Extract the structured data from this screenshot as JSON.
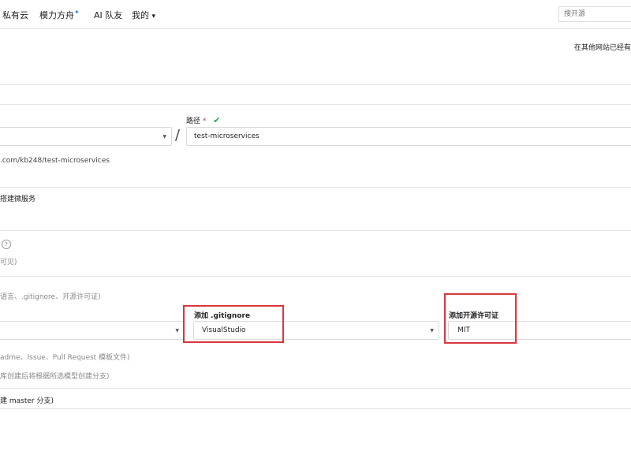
{
  "nav": {
    "items": [
      "私有云",
      "模力方舟",
      "AI 队友",
      "我的"
    ],
    "mine_caret": "▾"
  },
  "search": {
    "placeholder": "搜开源"
  },
  "top_right_text": "在其他网站已经有",
  "path": {
    "label": "路径",
    "required_mark": "*",
    "check": "✔",
    "separator": "/",
    "value": "test-microservices"
  },
  "repo_url_partial": ".com/kb248/test-microservices",
  "description_partial": "搭建微服务",
  "visibility": {
    "help_icon": "?",
    "note_partial": "可见)"
  },
  "init_hint_partial": "语言、.gitignore、开源许可证)",
  "gitignore": {
    "label": "添加 .gitignore",
    "value": "VisualStudio"
  },
  "license": {
    "label": "添加开源许可证",
    "value": "MIT"
  },
  "template_hint_partial": "adme、Issue、Pull Request 模板文件)",
  "branch_model_partial": "库创建后将根据所选模型创建分支)",
  "master_branch_partial": "建 master 分支)",
  "colors": {
    "highlight": "#d9363e",
    "check": "#2ea44f"
  }
}
